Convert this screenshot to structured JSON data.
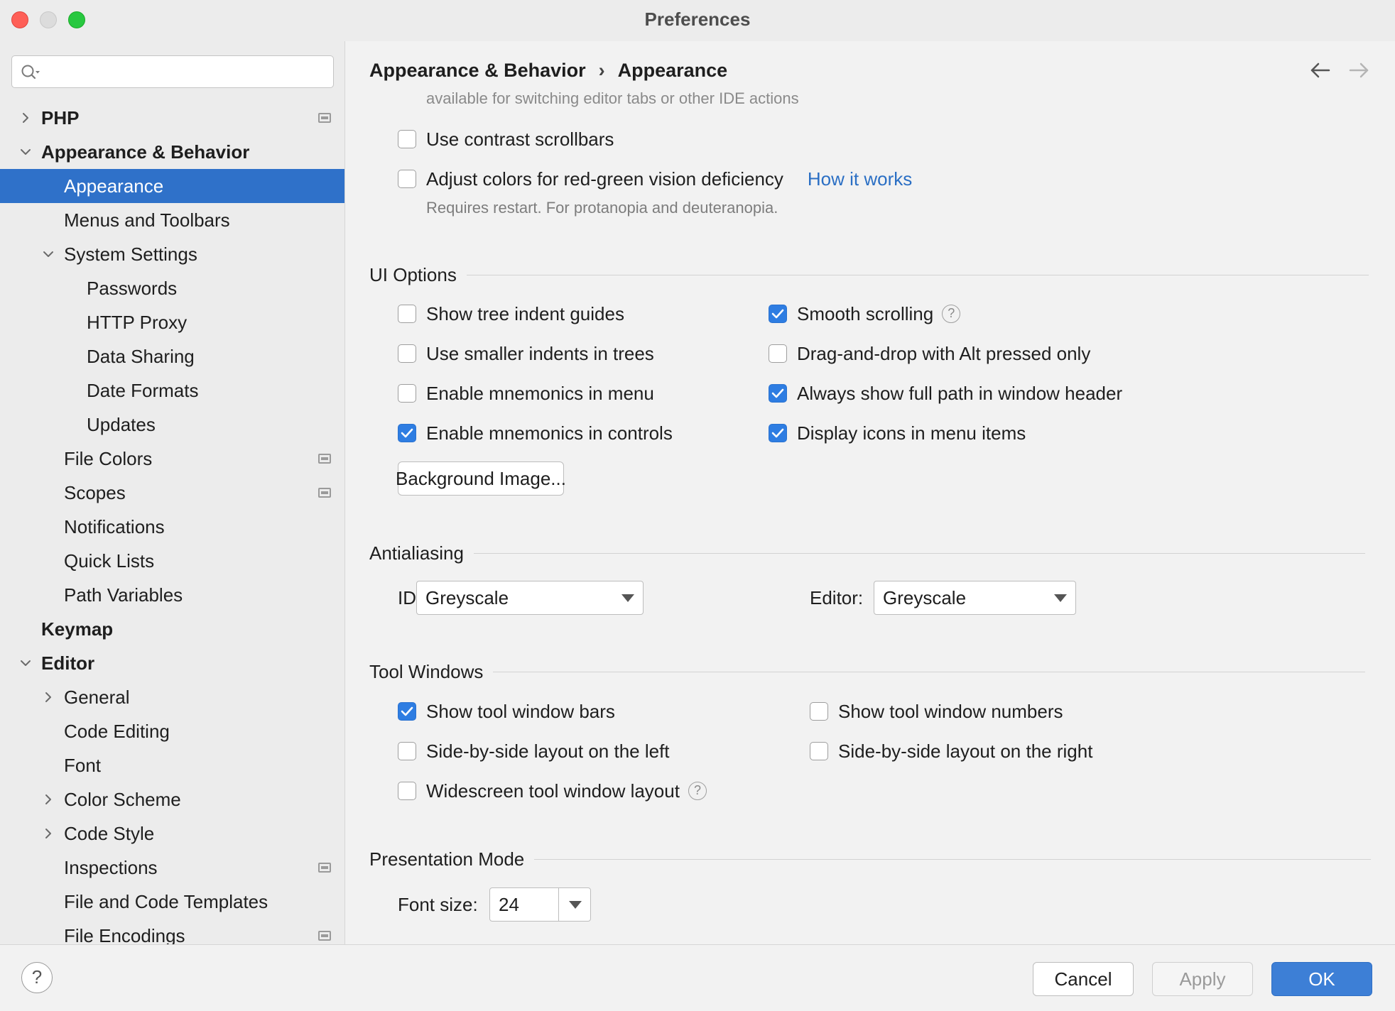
{
  "window": {
    "title": "Preferences"
  },
  "sidebar": {
    "search_placeholder": "",
    "items": [
      {
        "label": "PHP",
        "level": 0,
        "expander": "collapsed",
        "bold": true,
        "project_icon": true
      },
      {
        "label": "Appearance & Behavior",
        "level": 0,
        "expander": "expanded",
        "bold": true
      },
      {
        "label": "Appearance",
        "level": 1,
        "selected": true
      },
      {
        "label": "Menus and Toolbars",
        "level": 1
      },
      {
        "label": "System Settings",
        "level": 1,
        "expander": "expanded"
      },
      {
        "label": "Passwords",
        "level": 2
      },
      {
        "label": "HTTP Proxy",
        "level": 2
      },
      {
        "label": "Data Sharing",
        "level": 2
      },
      {
        "label": "Date Formats",
        "level": 2
      },
      {
        "label": "Updates",
        "level": 2
      },
      {
        "label": "File Colors",
        "level": 1,
        "project_icon": true
      },
      {
        "label": "Scopes",
        "level": 1,
        "project_icon": true
      },
      {
        "label": "Notifications",
        "level": 1
      },
      {
        "label": "Quick Lists",
        "level": 1
      },
      {
        "label": "Path Variables",
        "level": 1
      },
      {
        "label": "Keymap",
        "level": 0,
        "bold": true
      },
      {
        "label": "Editor",
        "level": 0,
        "expander": "expanded",
        "bold": true
      },
      {
        "label": "General",
        "level": 1,
        "expander": "collapsed"
      },
      {
        "label": "Code Editing",
        "level": 1
      },
      {
        "label": "Font",
        "level": 1
      },
      {
        "label": "Color Scheme",
        "level": 1,
        "expander": "collapsed"
      },
      {
        "label": "Code Style",
        "level": 1,
        "expander": "collapsed"
      },
      {
        "label": "Inspections",
        "level": 1,
        "project_icon": true
      },
      {
        "label": "File and Code Templates",
        "level": 1
      },
      {
        "label": "File Encodings",
        "level": 1,
        "project_icon": true
      }
    ]
  },
  "breadcrumb": {
    "parent": "Appearance & Behavior",
    "separator": "›",
    "current": "Appearance"
  },
  "content": {
    "clipped_text": "available for switching editor tabs or other IDE actions",
    "contrast_scrollbars": {
      "label": "Use contrast scrollbars",
      "checked": false
    },
    "red_green": {
      "label": "Adjust colors for red-green vision deficiency",
      "checked": false,
      "link": "How it works",
      "hint": "Requires restart. For protanopia and deuteranopia."
    },
    "ui_options": {
      "title": "UI Options",
      "left": [
        {
          "label": "Show tree indent guides",
          "checked": false
        },
        {
          "label": "Use smaller indents in trees",
          "checked": false
        },
        {
          "label": "Enable mnemonics in menu",
          "checked": false
        },
        {
          "label": "Enable mnemonics in controls",
          "checked": true
        }
      ],
      "right": [
        {
          "label": "Smooth scrolling",
          "checked": true,
          "help": true
        },
        {
          "label": "Drag-and-drop with Alt pressed only",
          "checked": false
        },
        {
          "label": "Always show full path in window header",
          "checked": true
        },
        {
          "label": "Display icons in menu items",
          "checked": true
        }
      ],
      "background_button": "Background Image..."
    },
    "antialiasing": {
      "title": "Antialiasing",
      "ide_label": "IDE:",
      "ide_value": "Greyscale",
      "editor_label": "Editor:",
      "editor_value": "Greyscale"
    },
    "tool_windows": {
      "title": "Tool Windows",
      "left": [
        {
          "label": "Show tool window bars",
          "checked": true
        },
        {
          "label": "Side-by-side layout on the left",
          "checked": false
        },
        {
          "label": "Widescreen tool window layout",
          "checked": false,
          "help": true
        }
      ],
      "right": [
        {
          "label": "Show tool window numbers",
          "checked": false
        },
        {
          "label": "Side-by-side layout on the right",
          "checked": false
        }
      ]
    },
    "presentation": {
      "title": "Presentation Mode",
      "font_size_label": "Font size:",
      "font_size_value": "24"
    }
  },
  "footer": {
    "help": "?",
    "cancel": "Cancel",
    "apply": "Apply",
    "ok": "OK"
  },
  "colors": {
    "accent": "#2f71c9",
    "link": "#2b6fc4",
    "ok_button": "#3d7fd6",
    "close": "#fe5f57",
    "maximize": "#28c840"
  }
}
